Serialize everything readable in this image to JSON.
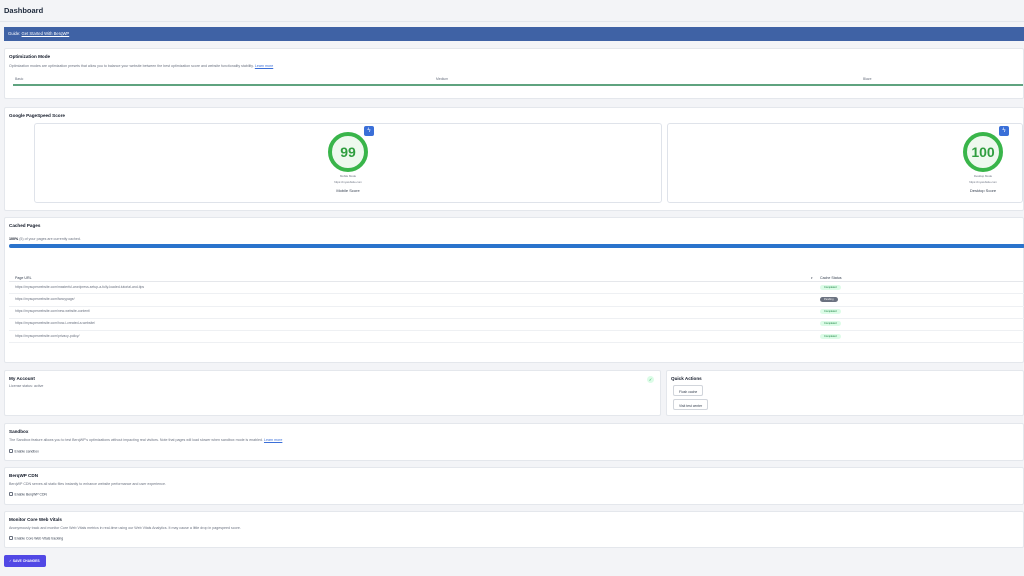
{
  "page": {
    "title": "Dashboard"
  },
  "guide": {
    "prefix": "Guide:",
    "link": "Get Started With BerqWP"
  },
  "optimization": {
    "title": "Optimization Mode",
    "description": "Optimization modes are optimization presets that allow you to balance your website between the best optimization score and website functionality stability.",
    "learn_more": "Learn more",
    "labels": [
      "Basic",
      "Medium",
      "Blaze"
    ]
  },
  "pagespeed": {
    "title": "Google PageSpeed Score",
    "mobile": {
      "score": "99",
      "mode": "Mobile Mode",
      "url": "https://mywebsite.com",
      "label": "Mobile Score",
      "badge_icon": "bolt-icon"
    },
    "desktop": {
      "score": "100",
      "mode": "Desktop Mode",
      "url": "https://mywebsite.com",
      "label": "Desktop Score",
      "badge_icon": "bolt-icon"
    },
    "accent": "#39b54a"
  },
  "cached": {
    "title": "Cached Pages",
    "percent_label": "100%",
    "percent_text": "(5) of your pages are currently cached.",
    "progress": 1.0,
    "headers": {
      "url": "Page URL",
      "status": "Cache Status"
    },
    "rows": [
      {
        "url": "https://mysuperwebsite.com/masterful-wordpress-setup-a-fully-loaded-tutorial-and-tips",
        "status": "Completed",
        "kind": "ok"
      },
      {
        "url": "https://mysuperwebsite.com/fancypage/",
        "status": "Pending",
        "kind": "pend"
      },
      {
        "url": "https://mysuperwebsite.com/new-website-content/",
        "status": "Completed",
        "kind": "ok"
      },
      {
        "url": "https://mysuperwebsite.com/how-i-created-a-website/",
        "status": "Completed",
        "kind": "ok"
      },
      {
        "url": "https://mysuperwebsite.com/privacy-policy/",
        "status": "Completed",
        "kind": "ok"
      }
    ]
  },
  "account": {
    "title": "My Account",
    "status": "License status: active"
  },
  "quick_actions": {
    "title": "Quick Actions",
    "flush": "Flush cache",
    "visit": "Visit test center"
  },
  "sandbox": {
    "title": "Sandbox",
    "description": "The Sandbox feature allows you to test BerqWP's optimizations without impacting real visitors. Note that pages will load slower when sandbox mode is enabled.",
    "learn_more": "Learn more",
    "checkbox": "Enable sandbox"
  },
  "cdn": {
    "title": "BerqWP CDN",
    "description": "BerqWP CDN serves all static files instantly to enhance website performance and user experience.",
    "checkbox": "Enable BerqWP CDN"
  },
  "cwv": {
    "title": "Monitor Core Web Vitals",
    "description": "Anonymously track and monitor Core Web Vitals metrics in real-time using our Web Vitals Analytics. It may cause a little drop in pagespeed score.",
    "checkbox": "Enable Core Web Vitals tracking"
  },
  "save": {
    "label": "SAVE CHANGES",
    "icon": "check-icon"
  }
}
